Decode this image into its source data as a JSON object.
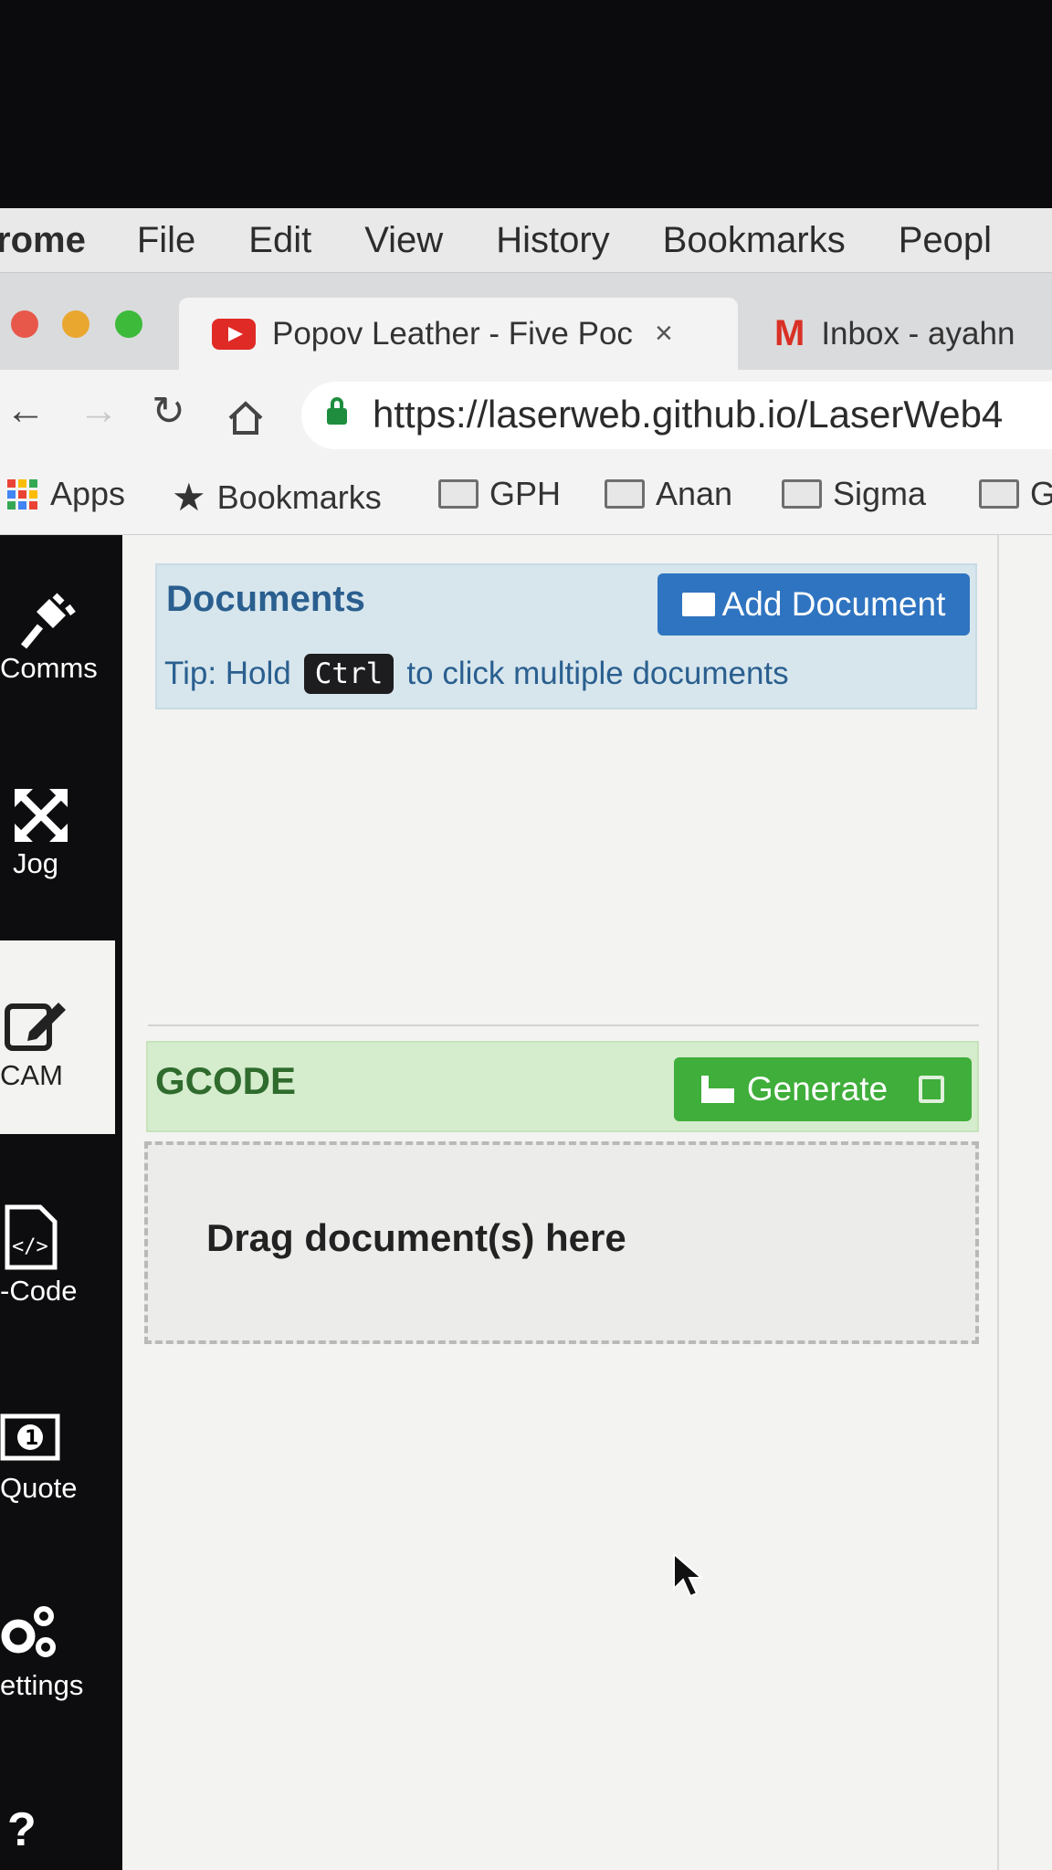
{
  "menubar": {
    "app": "rome",
    "items": [
      "File",
      "Edit",
      "View",
      "History",
      "Bookmarks",
      "Peopl"
    ]
  },
  "tabs": [
    {
      "title": "Popov Leather - Five Poc",
      "icon": "youtube-icon",
      "close": "×"
    },
    {
      "title": "Inbox - ayahn",
      "icon": "gmail-icon"
    }
  ],
  "address": {
    "url": "https://laserweb.github.io/LaserWeb4"
  },
  "bookmarks": [
    {
      "label": "Apps",
      "icon": "apps-grid-icon"
    },
    {
      "label": "Bookmarks",
      "icon": "star-icon"
    },
    {
      "label": "GPH",
      "icon": "folder-icon"
    },
    {
      "label": "Anan",
      "icon": "folder-icon"
    },
    {
      "label": "Sigma",
      "icon": "folder-icon"
    },
    {
      "label": "G",
      "icon": "folder-icon"
    }
  ],
  "sidebar": {
    "items": [
      {
        "label": "Comms",
        "icon": "plug-icon"
      },
      {
        "label": "Jog",
        "icon": "arrows-icon"
      },
      {
        "label": "CAM",
        "icon": "edit-icon",
        "active": true
      },
      {
        "label": "-Code",
        "icon": "code-file-icon"
      },
      {
        "label": "Quote",
        "icon": "money-icon"
      },
      {
        "label": "ettings",
        "icon": "gears-icon"
      },
      {
        "label": "?",
        "icon": "help-icon"
      }
    ]
  },
  "documents": {
    "title": "Documents",
    "add_button": "Add Document",
    "tip_before": "Tip: Hold",
    "tip_key": "Ctrl",
    "tip_after": "to click multiple documents"
  },
  "gcode": {
    "title": "GCODE",
    "generate_button": "Generate",
    "drop_text": "Drag document(s) here"
  },
  "colors": {
    "documents_bg": "#d7e6ed",
    "primary_button": "#2f74c0",
    "gcode_bg": "#d5eccd",
    "success_button": "#3fae3a"
  }
}
